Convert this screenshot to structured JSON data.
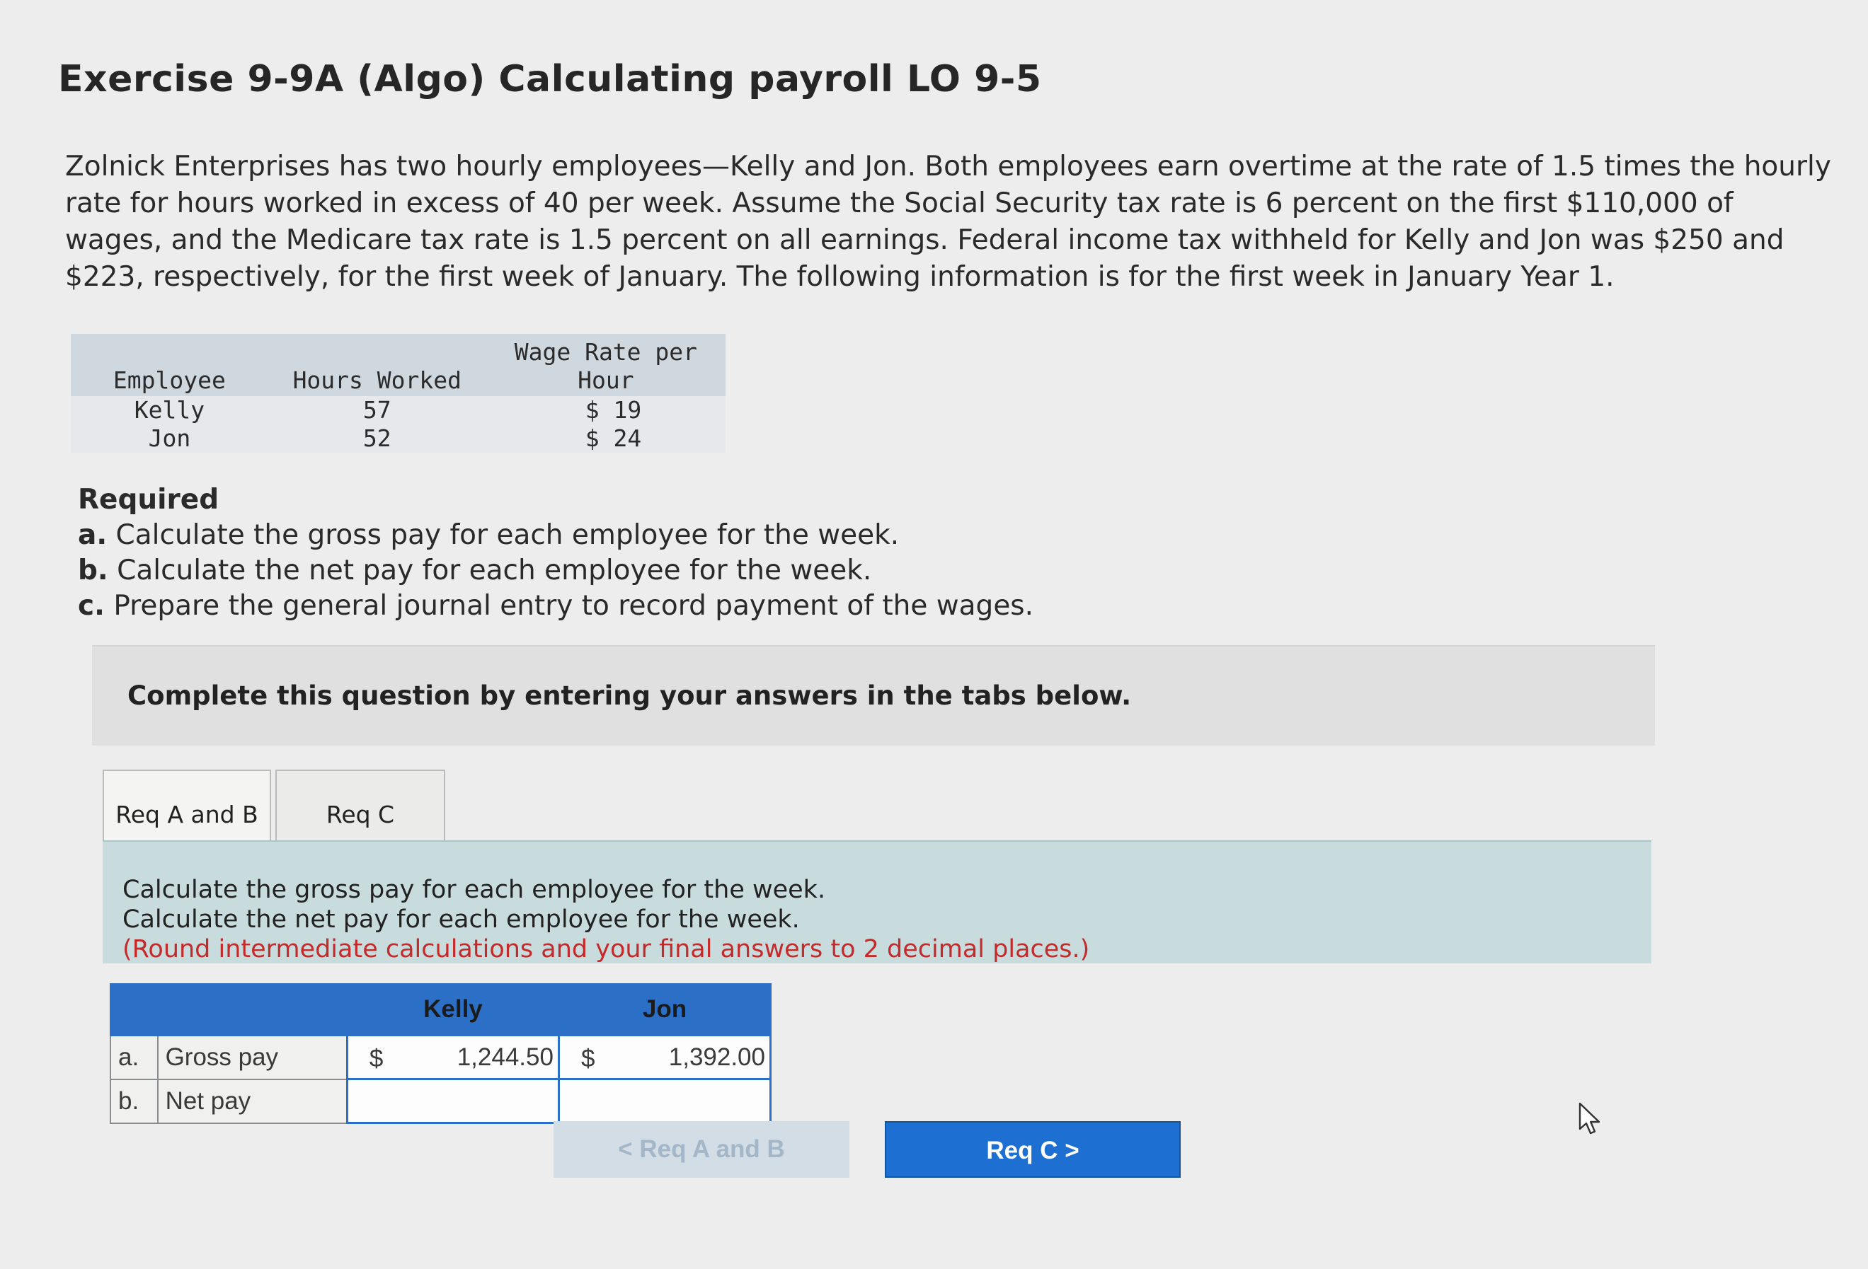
{
  "title": "Exercise 9-9A (Algo) Calculating payroll LO 9-5",
  "problem_text": "Zolnick Enterprises has two hourly employees—Kelly and Jon. Both employees earn overtime at the rate of 1.5 times the hourly rate for hours worked in excess of 40 per week. Assume the Social Security tax rate is 6 percent on the first $110,000 of wages, and the Medicare tax rate is 1.5 percent on all earnings. Federal income tax withheld for Kelly and Jon was $250 and $223, respectively, for the first week of January. The following information is for the first week in January Year 1.",
  "employee_table": {
    "headers": [
      "Employee",
      "Hours Worked",
      "Wage Rate per Hour"
    ],
    "rows": [
      {
        "employee": "Kelly",
        "hours": "57",
        "rate": "$ 19"
      },
      {
        "employee": "Jon",
        "hours": "52",
        "rate": "$ 24"
      }
    ]
  },
  "required": {
    "heading": "Required",
    "items": [
      {
        "label": "a.",
        "text": "Calculate the gross pay for each employee for the week."
      },
      {
        "label": "b.",
        "text": "Calculate the net pay for each employee for the week."
      },
      {
        "label": "c.",
        "text": "Prepare the general journal entry to record payment of the wages."
      }
    ]
  },
  "banner": "Complete this question by entering your answers in the tabs below.",
  "tabs": [
    {
      "label": "Req A and B",
      "active": true
    },
    {
      "label": "Req C",
      "active": false
    }
  ],
  "instructions": {
    "line1": "Calculate the gross pay for each employee for the week.",
    "line2": "Calculate the net pay for each employee for the week.",
    "line3": "(Round intermediate calculations and your final answers to 2 decimal places.)"
  },
  "answer_table": {
    "columns": [
      "Kelly",
      "Jon"
    ],
    "rows": [
      {
        "idx": "a.",
        "label": "Gross pay",
        "kelly_currency": "$",
        "kelly": "1,244.50",
        "jon_currency": "$",
        "jon": "1,392.00"
      },
      {
        "idx": "b.",
        "label": "Net pay",
        "kelly_currency": "",
        "kelly": "",
        "jon_currency": "",
        "jon": ""
      }
    ]
  },
  "nav": {
    "prev": "< Req A and B",
    "next": "Req C >"
  },
  "colors": {
    "accent": "#2c6fc7",
    "panel": "#c8dcde",
    "warning_text": "#c42a2a"
  }
}
